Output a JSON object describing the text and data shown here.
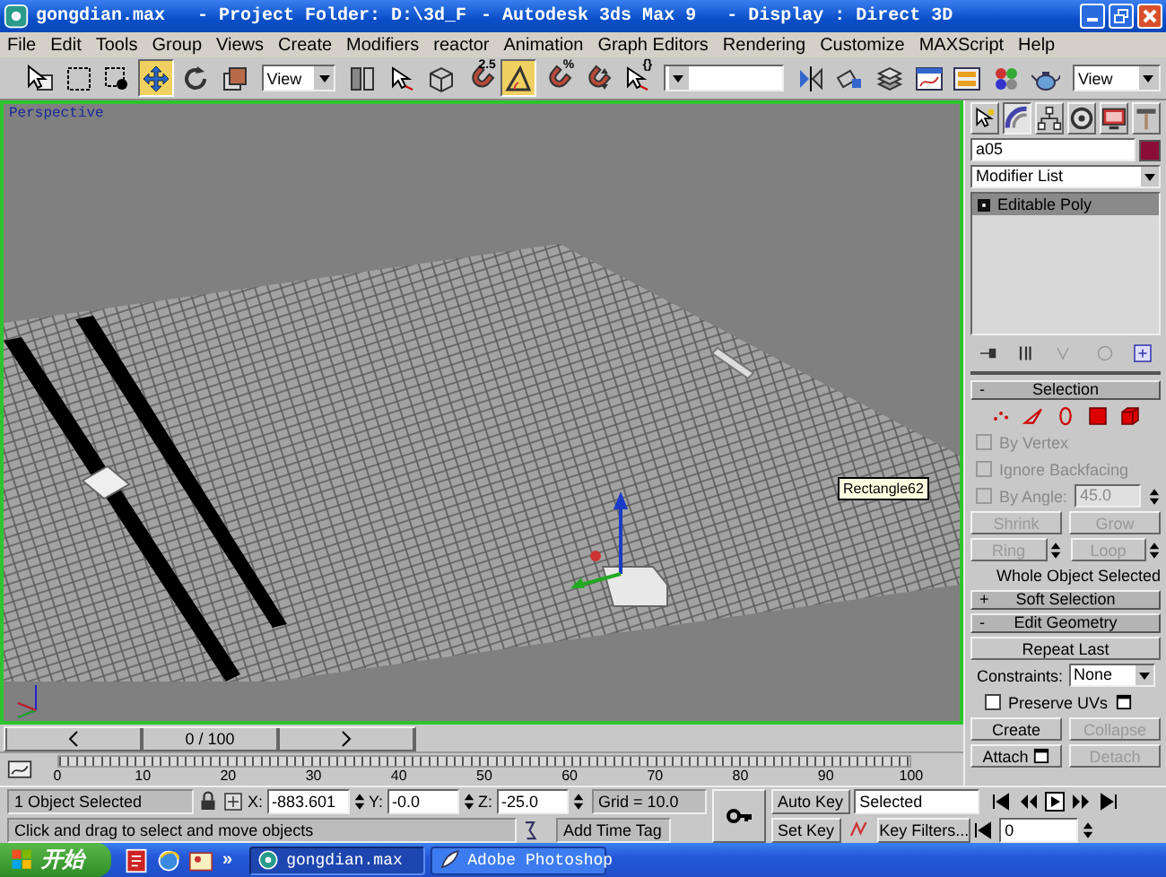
{
  "window": {
    "title": "gongdian.max",
    "project": "- Project Folder: D:\\3d_F",
    "app": "- Autodesk 3ds Max 9",
    "display": "- Display : Direct 3D"
  },
  "menu": [
    "File",
    "Edit",
    "Tools",
    "Group",
    "Views",
    "Create",
    "Modifiers",
    "reactor",
    "Animation",
    "Graph Editors",
    "Rendering",
    "Customize",
    "MAXScript",
    "Help"
  ],
  "toolbar": [
    {
      "kind": "tool",
      "selected": false
    },
    {
      "kind": "tool",
      "selected": false
    },
    {
      "kind": "tool",
      "selected": false
    },
    {
      "kind": "tool",
      "selected": true
    },
    {
      "kind": "tool",
      "selected": false
    },
    {
      "kind": "tool",
      "selected": false
    },
    {
      "kind": "dropdown",
      "value": "View"
    },
    {
      "kind": "tool",
      "selected": false
    },
    {
      "kind": "tool",
      "selected": false
    },
    {
      "kind": "tool",
      "selected": false
    },
    {
      "kind": "tool",
      "selected": false,
      "badge": "2.5"
    },
    {
      "kind": "tool",
      "selected": true
    },
    {
      "kind": "tool",
      "selected": false,
      "badge": "%"
    },
    {
      "kind": "tool",
      "selected": false
    },
    {
      "kind": "tool",
      "selected": false,
      "badge": "{}"
    },
    {
      "kind": "dropdown"
    },
    {
      "kind": "tool",
      "selected": false
    },
    {
      "kind": "tool",
      "selected": false
    },
    {
      "kind": "tool",
      "selected": false
    },
    {
      "kind": "tool",
      "selected": false
    },
    {
      "kind": "tool",
      "selected": false
    },
    {
      "kind": "tool",
      "selected": false
    },
    {
      "kind": "tool",
      "selected": false
    },
    {
      "kind": "dropdown",
      "value": "View"
    }
  ],
  "viewport": {
    "label": "Perspective",
    "active": true,
    "tooltip": "Rectangle62"
  },
  "time_slider": {
    "label": "0 / 100",
    "level": 0
  },
  "track_bar": {
    "ticks": [
      "0",
      "10",
      "20",
      "30",
      "40",
      "50",
      "60",
      "70",
      "80",
      "90",
      "100"
    ]
  },
  "command_panel": {
    "tabs": [
      {
        "selected": false
      },
      {
        "selected": true
      },
      {
        "selected": false
      },
      {
        "selected": false
      },
      {
        "selected": false
      },
      {
        "selected": false
      }
    ],
    "object_name": "a05",
    "modifier_list": "Modifier List",
    "stack": [
      {
        "label": "Editable Poly",
        "selected": true
      }
    ],
    "rollouts": [
      {
        "kind": "selection",
        "sign": "-",
        "title": "Selection",
        "options": [
          {
            "label": "By Vertex",
            "checked": false,
            "disabled": true
          },
          {
            "label": "Ignore Backfacing",
            "checked": false,
            "disabled": true
          },
          {
            "label": "By Angle:",
            "checked": false,
            "disabled": true,
            "value": "45.0"
          }
        ],
        "buttons": [
          {
            "label": "Shrink",
            "disabled": true
          },
          {
            "label": "Grow",
            "disabled": true
          },
          {
            "label": "Ring",
            "disabled": true
          },
          {
            "label": "Loop",
            "disabled": true
          }
        ],
        "status": "Whole Object Selected"
      },
      {
        "kind": "collapsed",
        "sign": "+",
        "title": "Soft Selection"
      },
      {
        "kind": "edit_geometry",
        "sign": "-",
        "title": "Edit Geometry",
        "repeat": {
          "label": "Repeat Last",
          "disabled": false
        },
        "constraints_label": "Constraints:",
        "constraints_value": "None",
        "preserve_uvs": {
          "label": "Preserve UVs",
          "checked": false
        },
        "buttons": [
          {
            "label": "Create",
            "disabled": false
          },
          {
            "label": "Collapse",
            "disabled": true
          },
          {
            "label": "Attach",
            "disabled": false,
            "settings": true
          },
          {
            "label": "Detach",
            "disabled": true
          }
        ]
      }
    ]
  },
  "status_bar": {
    "selection": "1 Object Selected",
    "coords": [
      {
        "axis": "X:",
        "value": "-883.601"
      },
      {
        "axis": "Y:",
        "value": "-0.0"
      },
      {
        "axis": "Z:",
        "value": "-25.0"
      }
    ],
    "grid": "Grid = 10.0",
    "prompt": "Click and drag to select and move objects",
    "time_tag": "Add Time Tag",
    "auto_key": "Auto Key",
    "key_mode": "Selected",
    "set_key": "Set Key",
    "key_filters": "Key Filters...",
    "frame": "0"
  },
  "taskbar": {
    "start": "开始",
    "more": "»",
    "tasks": [
      {
        "label": "gongdian.max",
        "selected": true
      },
      {
        "label": "Adobe Photoshop",
        "selected": false
      }
    ]
  }
}
